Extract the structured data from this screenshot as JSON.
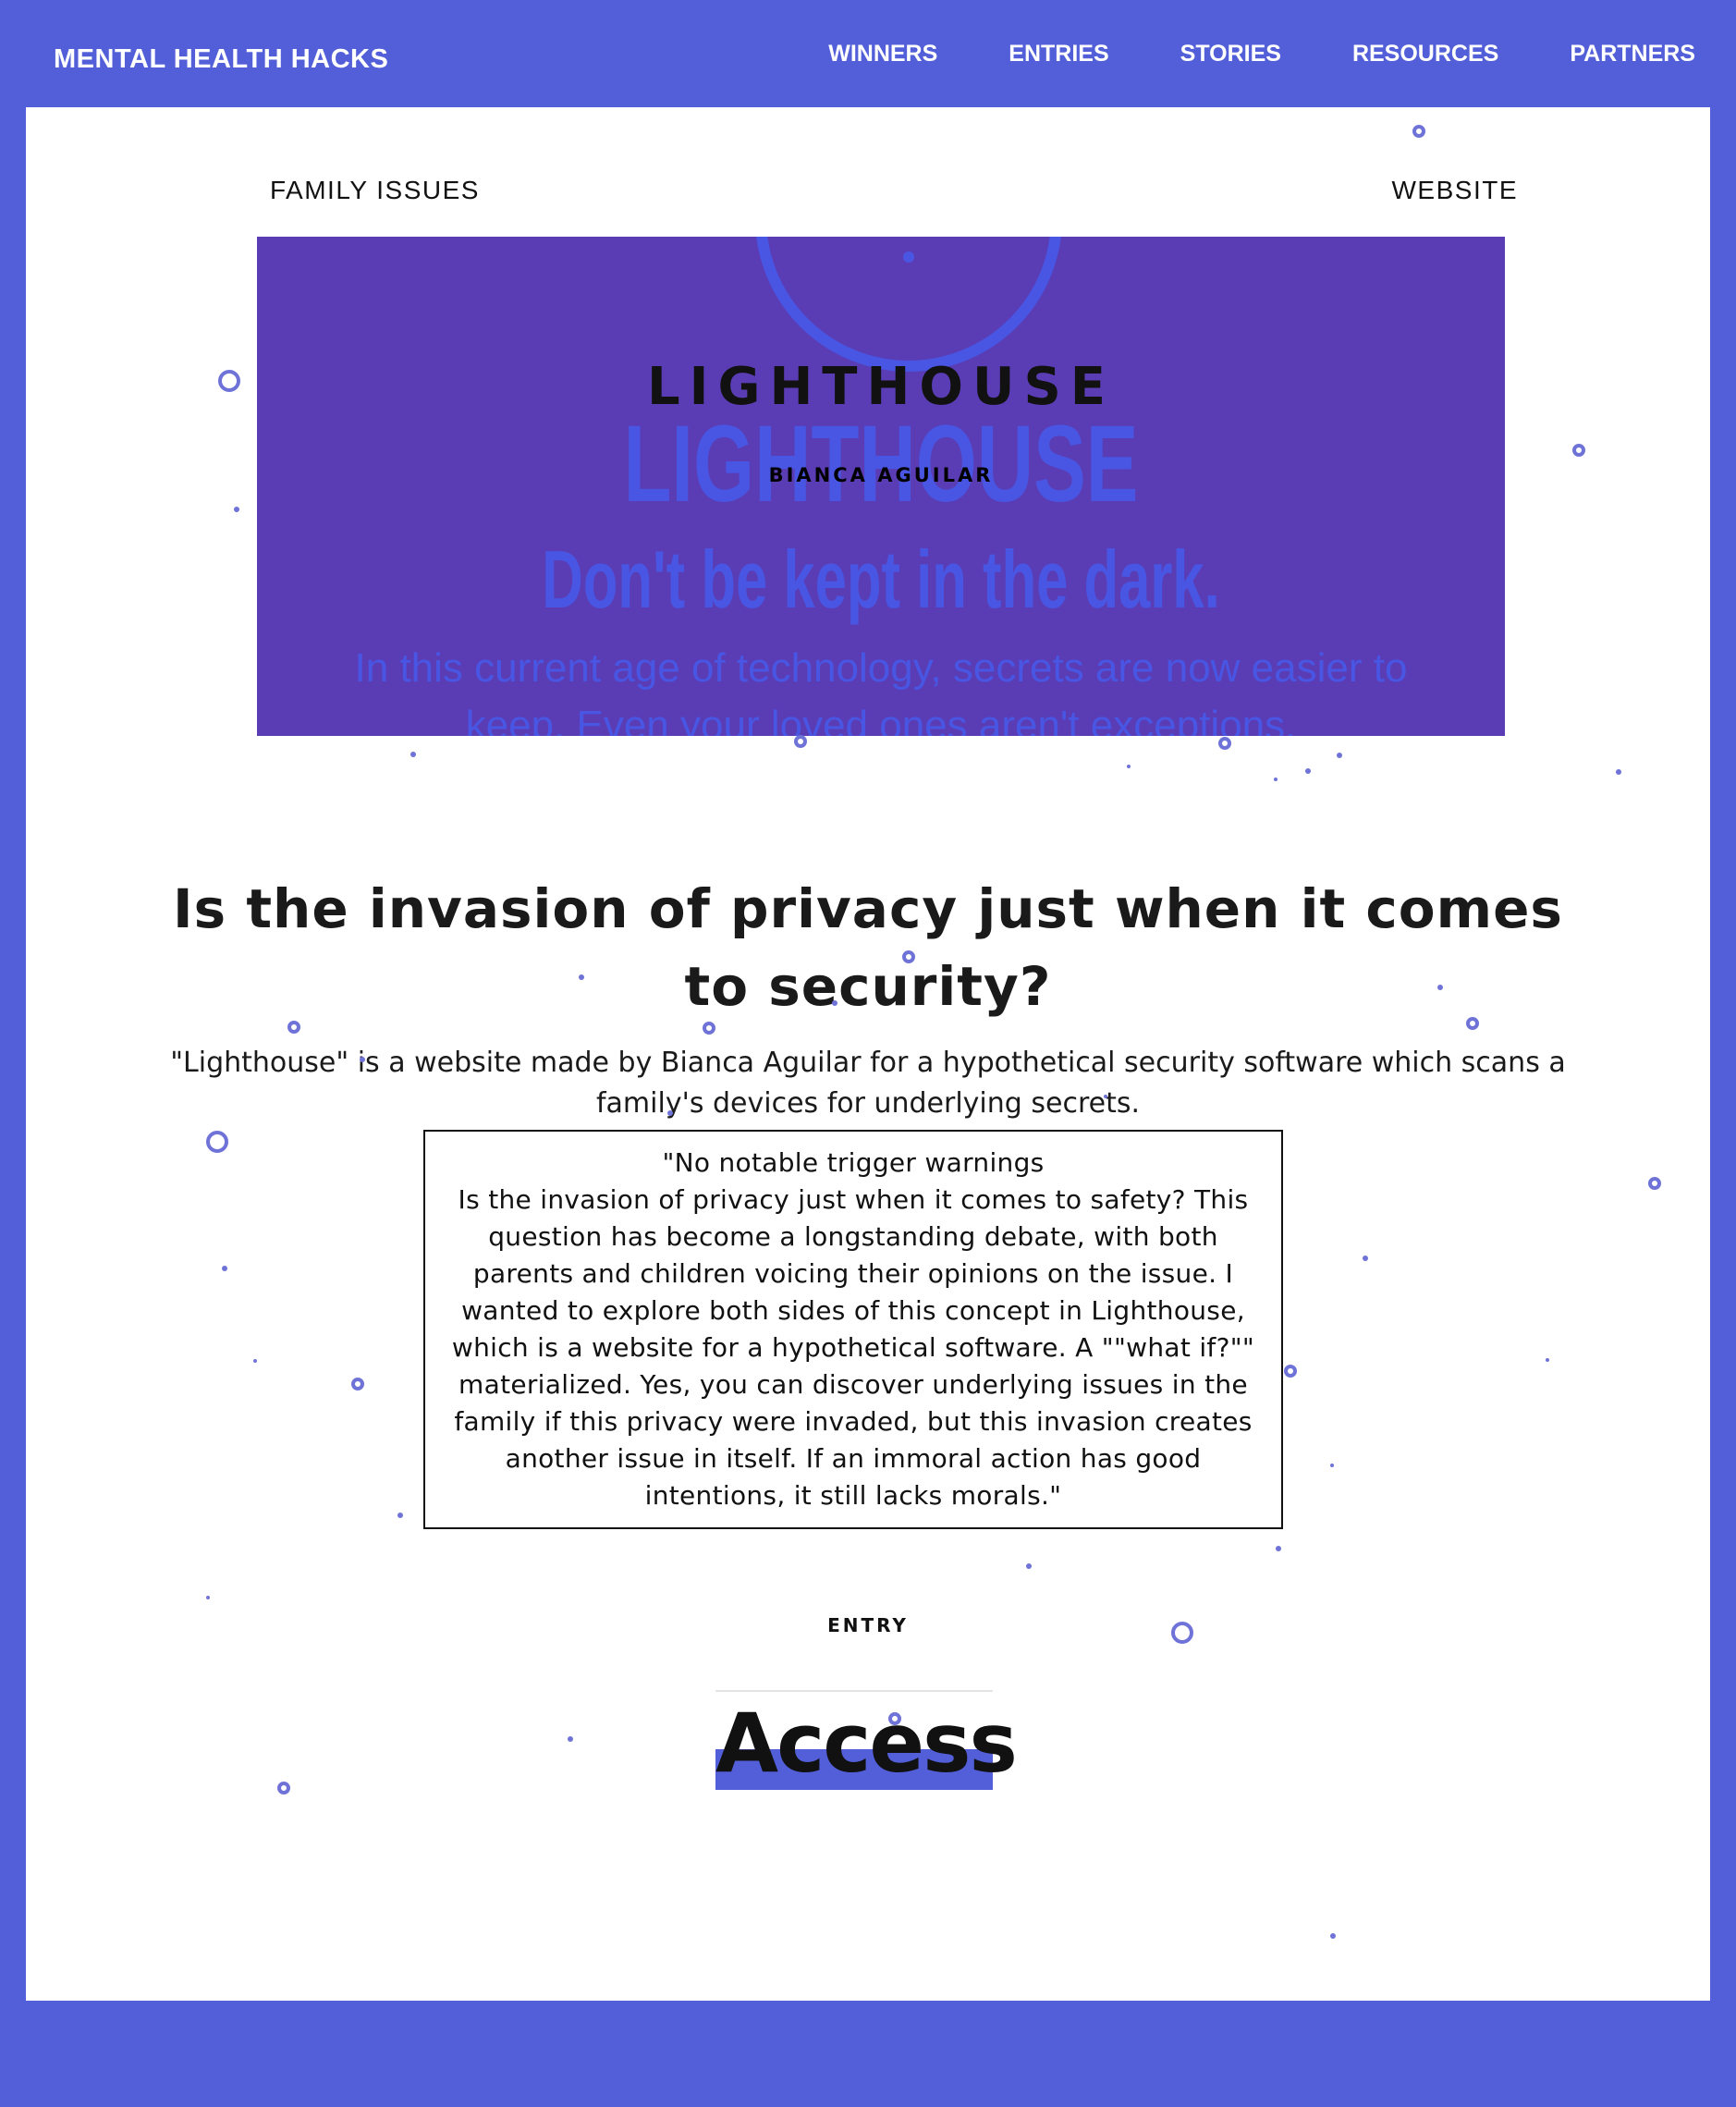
{
  "site": {
    "brand": "MENTAL HEALTH HACKS"
  },
  "nav": {
    "items": [
      {
        "label": "WINNERS"
      },
      {
        "label": "ENTRIES"
      },
      {
        "label": "STORIES"
      },
      {
        "label": "RESOURCES"
      },
      {
        "label": "PARTNERS"
      }
    ]
  },
  "entry": {
    "category": "FAMILY ISSUES",
    "medium": "WEBSITE",
    "hero": {
      "title": "LIGHTHOUSE",
      "author": "BIANCA AGUILAR",
      "ghost_title": "LIGHTHOUSE",
      "ghost_tagline": "Don't be kept in the dark.",
      "ghost_body": "In this current age of technology, secrets are now easier to keep. Even your loved ones aren't exceptions."
    },
    "headline": "Is the invasion of privacy just when it comes to security?",
    "description": "\"Lighthouse\" is a website made by Bianca Aguilar for a hypothetical security software which scans a family's devices for underlying secrets.",
    "statement": "\"No notable trigger warnings\nIs the invasion of privacy just when it comes to safety? This question has become a longstanding debate, with both parents and children voicing their opinions on the issue. I wanted to explore both sides of this concept in Lighthouse, which is a website for a hypothetical software. A \"\"what if?\"\" materialized. Yes, you can discover underlying issues in the family if this privacy were invaded, but this invasion creates another issue in itself. If an immoral action has good intentions, it still lacks morals.\"",
    "entry_label": "ENTRY",
    "access_label": "Access"
  },
  "colors": {
    "brand_blue": "#525fd9",
    "hero_purple": "#5a3db5",
    "ghost_blue": "#4856e3",
    "dot": "#6f73d8"
  }
}
